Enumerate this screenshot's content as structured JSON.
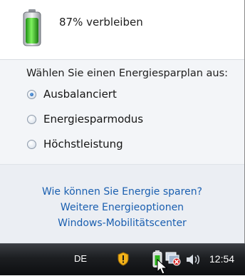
{
  "battery": {
    "status_text": "87% verbleiben",
    "charge_percent": 87,
    "icon": "battery-icon"
  },
  "power_plans": {
    "heading": "Wählen Sie einen Energiesparplan aus:",
    "options": [
      {
        "label": "Ausbalanciert",
        "selected": true
      },
      {
        "label": "Energiesparmodus",
        "selected": false
      },
      {
        "label": "Höchstleistung",
        "selected": false
      }
    ]
  },
  "links": [
    "Wie können Sie Energie sparen?",
    "Weitere Energieoptionen",
    "Windows-Mobilitätscenter"
  ],
  "taskbar": {
    "language": "DE",
    "clock": "12:54",
    "tray_icons": [
      "shield-icon",
      "battery-icon",
      "network-icon",
      "speaker-icon"
    ]
  },
  "colors": {
    "link": "#1a5fb0",
    "battery_green": "#3fbf2a",
    "taskbar": "#1c1e21"
  }
}
